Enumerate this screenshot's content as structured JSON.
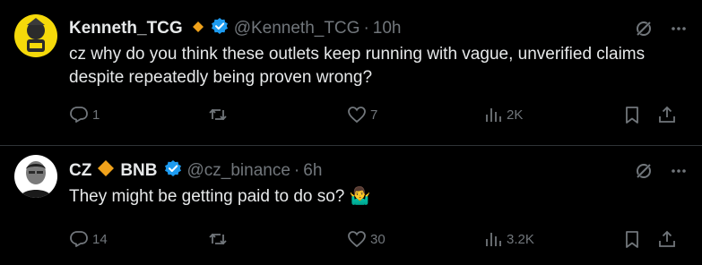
{
  "tweets": [
    {
      "name": "Kenneth_TCG",
      "handle": "@Kenneth_TCG",
      "time": "10h",
      "text": "cz why do you think these outlets keep running with vague, unverified claims despite repeatedly being proven wrong?",
      "replies": "1",
      "retweets": "",
      "likes": "7",
      "views": "2K"
    },
    {
      "name_part1": "CZ",
      "name_part2": "BNB",
      "handle": "@cz_binance",
      "time": "6h",
      "text": "They might be getting paid to do so? 🤷‍♂️",
      "replies": "14",
      "retweets": "",
      "likes": "30",
      "views": "3.2K"
    }
  ],
  "icons": {
    "verified": "verified-badge-icon",
    "diamond": "orange-diamond-icon",
    "grok": "grok-icon",
    "more": "more-icon",
    "reply": "reply-icon",
    "retweet": "retweet-icon",
    "like": "like-icon",
    "views": "views-icon",
    "bookmark": "bookmark-icon",
    "share": "share-icon"
  },
  "colors": {
    "background": "#000000",
    "text": "#e7e9ea",
    "muted": "#71767b",
    "verified": "#1d9bf0",
    "diamond": "#f0a21b",
    "divider": "#2f3336"
  }
}
